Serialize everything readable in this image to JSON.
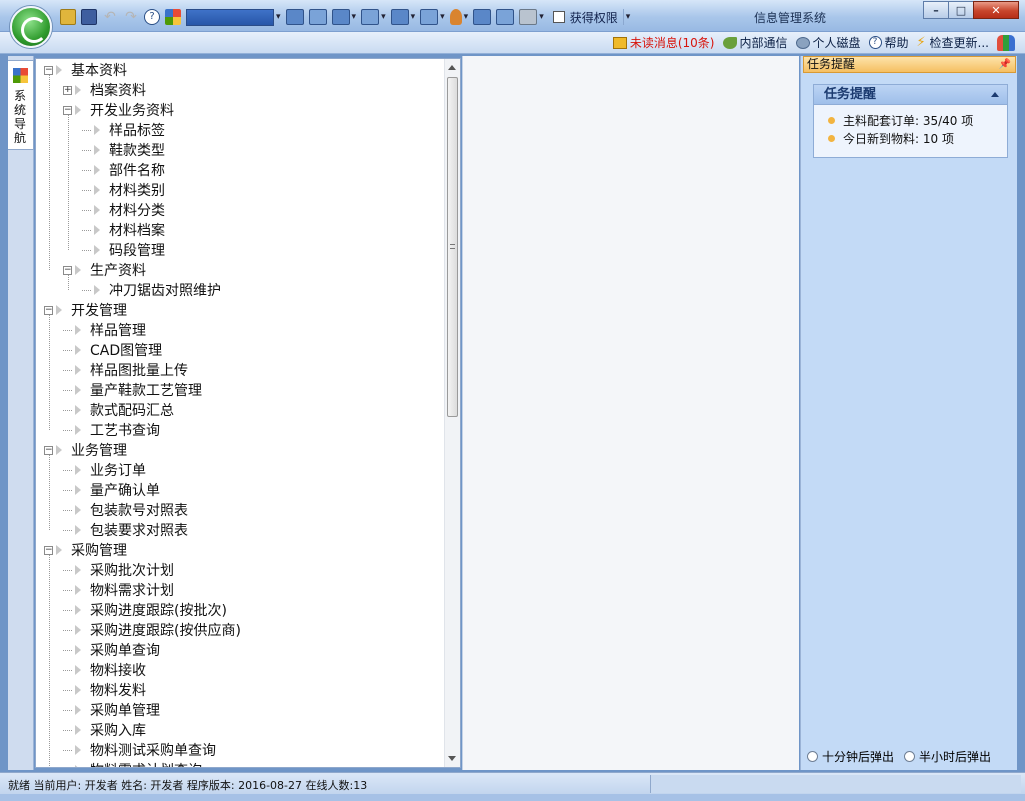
{
  "window": {
    "title": "信息管理系统",
    "controls": [
      "minimize",
      "maximize",
      "close"
    ]
  },
  "toolbar": {
    "permission_checkbox_label": "获得权限",
    "permission_checked": false
  },
  "infobar": {
    "unread": "未读消息(10条)",
    "internal": "内部通信",
    "disk": "个人磁盘",
    "help": "帮助",
    "update": "检查更新..."
  },
  "nav_tab": {
    "label": "系统导航"
  },
  "tree": {
    "items": [
      {
        "label": "基本资料",
        "level": 0,
        "expander": "minus"
      },
      {
        "label": "档案资料",
        "level": 1,
        "expander": "plus"
      },
      {
        "label": "开发业务资料",
        "level": 1,
        "expander": "minus"
      },
      {
        "label": "样品标签",
        "level": 2,
        "expander": "none"
      },
      {
        "label": "鞋款类型",
        "level": 2,
        "expander": "none"
      },
      {
        "label": "部件名称",
        "level": 2,
        "expander": "none"
      },
      {
        "label": "材料类别",
        "level": 2,
        "expander": "none"
      },
      {
        "label": "材料分类",
        "level": 2,
        "expander": "none"
      },
      {
        "label": "材料档案",
        "level": 2,
        "expander": "none"
      },
      {
        "label": "码段管理",
        "level": 2,
        "expander": "none"
      },
      {
        "label": "生产资料",
        "level": 1,
        "expander": "minus"
      },
      {
        "label": "冲刀锯齿对照维护",
        "level": 2,
        "expander": "none"
      },
      {
        "label": "开发管理",
        "level": 0,
        "expander": "minus"
      },
      {
        "label": "样品管理",
        "level": 1,
        "expander": "none"
      },
      {
        "label": "CAD图管理",
        "level": 1,
        "expander": "none"
      },
      {
        "label": "样品图批量上传",
        "level": 1,
        "expander": "none"
      },
      {
        "label": "量产鞋款工艺管理",
        "level": 1,
        "expander": "none"
      },
      {
        "label": "款式配码汇总",
        "level": 1,
        "expander": "none"
      },
      {
        "label": "工艺书查询",
        "level": 1,
        "expander": "none"
      },
      {
        "label": "业务管理",
        "level": 0,
        "expander": "minus"
      },
      {
        "label": "业务订单",
        "level": 1,
        "expander": "none"
      },
      {
        "label": "量产确认单",
        "level": 1,
        "expander": "none"
      },
      {
        "label": "包装款号对照表",
        "level": 1,
        "expander": "none"
      },
      {
        "label": "包装要求对照表",
        "level": 1,
        "expander": "none"
      },
      {
        "label": "采购管理",
        "level": 0,
        "expander": "minus"
      },
      {
        "label": "采购批次计划",
        "level": 1,
        "expander": "none"
      },
      {
        "label": "物料需求计划",
        "level": 1,
        "expander": "none"
      },
      {
        "label": "采购进度跟踪(按批次)",
        "level": 1,
        "expander": "none"
      },
      {
        "label": "采购进度跟踪(按供应商)",
        "level": 1,
        "expander": "none"
      },
      {
        "label": "采购单查询",
        "level": 1,
        "expander": "none"
      },
      {
        "label": "物料接收",
        "level": 1,
        "expander": "none"
      },
      {
        "label": "物料发料",
        "level": 1,
        "expander": "none"
      },
      {
        "label": "采购单管理",
        "level": 1,
        "expander": "none"
      },
      {
        "label": "采购入库",
        "level": 1,
        "expander": "none"
      },
      {
        "label": "物料测试采购单查询",
        "level": 1,
        "expander": "none"
      },
      {
        "label": "物料需求计划查询",
        "level": 1,
        "expander": "none"
      }
    ]
  },
  "task_panel": {
    "header": "任务提醒",
    "card_title": "任务提醒",
    "items": [
      "主料配套订单: 35/40 项",
      "今日新到物料: 10 项"
    ],
    "radio_10min": "十分钟后弹出",
    "radio_30min": "半小时后弹出"
  },
  "status": {
    "text": "就绪 当前用户: 开发者 姓名: 开发者 程序版本: 2016-08-27 在线人数:13"
  }
}
